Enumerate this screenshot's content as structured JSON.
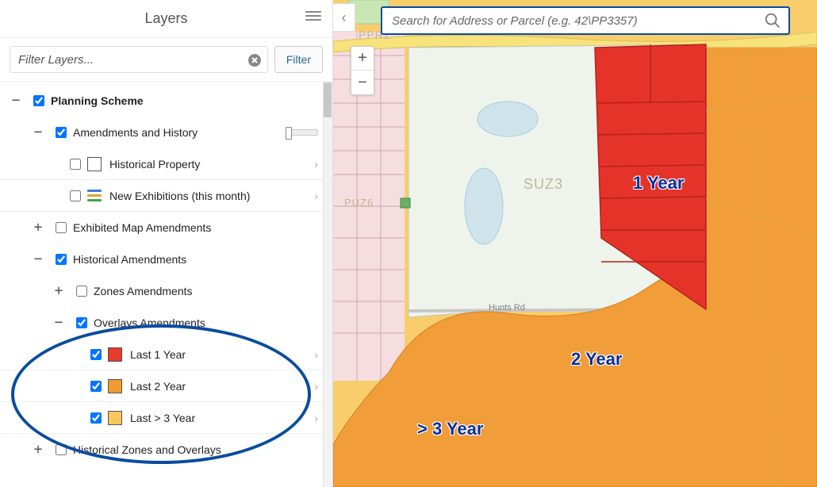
{
  "sidebar": {
    "title": "Layers",
    "filter_placeholder": "Filter Layers...",
    "filter_button": "Filter"
  },
  "tree": {
    "planning_scheme": {
      "label": "Planning Scheme",
      "expanded": true,
      "checked": true
    },
    "amend_history": {
      "label": "Amendments and History",
      "expanded": true,
      "checked": true
    },
    "historical_property": {
      "label": "Historical Property",
      "checked": false
    },
    "new_exhibitions": {
      "label": "New Exhibitions (this month)",
      "checked": false
    },
    "exhibited_map": {
      "label": "Exhibited Map Amendments",
      "expanded": false,
      "checked": false
    },
    "historical_amend": {
      "label": "Historical Amendments",
      "expanded": true,
      "checked": true
    },
    "zones_amend": {
      "label": "Zones Amendments",
      "expanded": false,
      "checked": false
    },
    "overlays_amend": {
      "label": "Overlays Amendments",
      "expanded": true,
      "checked": true
    },
    "last1": {
      "label": "Last 1 Year",
      "checked": true,
      "swatch": "#e63a2a"
    },
    "last2": {
      "label": "Last 2 Year",
      "checked": true,
      "swatch": "#ef9c2e"
    },
    "last3": {
      "label": "Last > 3 Year",
      "checked": true,
      "swatch": "#f8c65a"
    },
    "hist_zones_overlays": {
      "label": "Historical Zones and Overlays",
      "expanded": false,
      "checked": false
    }
  },
  "map": {
    "search_placeholder": "Search for Address or Parcel (e.g. 42\\PP3357)",
    "labels": {
      "y1": "1 Year",
      "y2": "2 Year",
      "y3": "> 3 Year",
      "suz": "SUZ3",
      "puz": "PUZ6",
      "ppr": "PPRZ",
      "hunts": "Hunts Rd"
    }
  }
}
